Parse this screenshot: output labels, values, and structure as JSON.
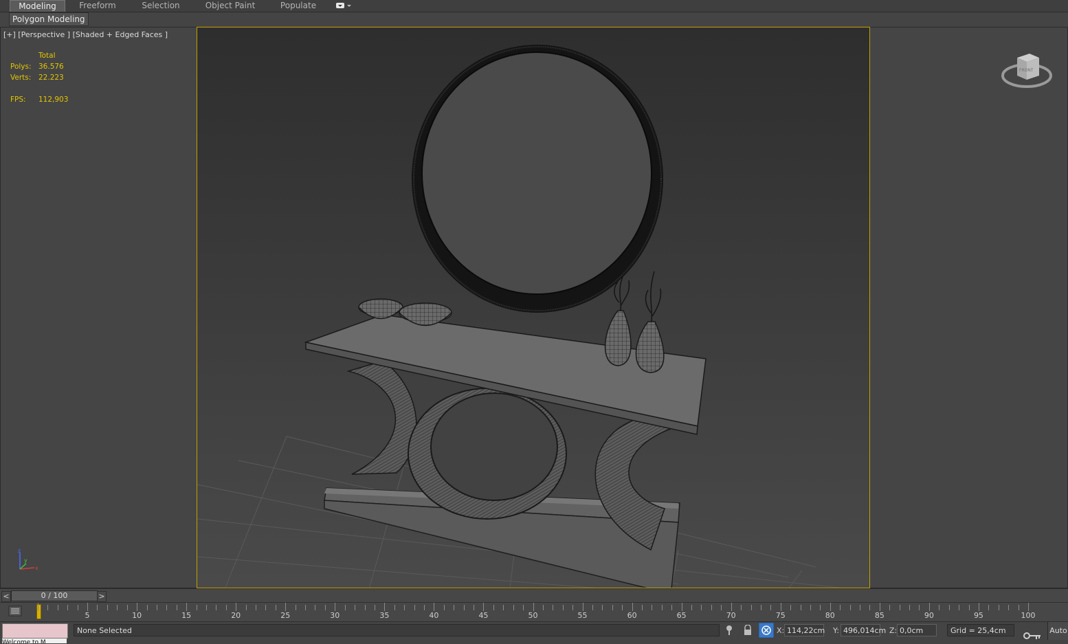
{
  "ribbon": {
    "tabs": [
      {
        "label": "Modeling",
        "active": true
      },
      {
        "label": "Freeform",
        "active": false
      },
      {
        "label": "Selection",
        "active": false
      },
      {
        "label": "Object Paint",
        "active": false
      },
      {
        "label": "Populate",
        "active": false
      }
    ],
    "sub_tab": "Polygon Modeling"
  },
  "viewport": {
    "label": "[+] [Perspective ] [Shaded + Edged Faces ]",
    "stats": {
      "header": "Total",
      "polys_label": "Polys:",
      "polys": "36.576",
      "verts_label": "Verts:",
      "verts": "22.223",
      "fps_label": "FPS:",
      "fps": "112,903"
    },
    "viewcube_icon": "viewcube-icon",
    "axis_gizmo_icon": "axis-tripod-icon",
    "active_border_color": "#c2a000"
  },
  "timeline": {
    "frame_display": "0 / 100",
    "prev_label": "<",
    "next_label": ">",
    "ticks": [
      "5",
      "10",
      "15",
      "20",
      "25",
      "30",
      "35",
      "40",
      "45",
      "50",
      "55",
      "60",
      "65",
      "70",
      "75",
      "80",
      "85",
      "90",
      "95",
      "100"
    ]
  },
  "status": {
    "selection": "None Selected",
    "x_label": "X:",
    "x_value": "114,22cm",
    "y_label": "Y:",
    "y_value": "496,014cm",
    "z_label": "Z:",
    "z_value": "0,0cm",
    "grid": "Grid = 25,4cm",
    "auto_label": "Auto",
    "maxscript_text": "Welcome to M",
    "swatch_color": "#e7c6cb"
  }
}
